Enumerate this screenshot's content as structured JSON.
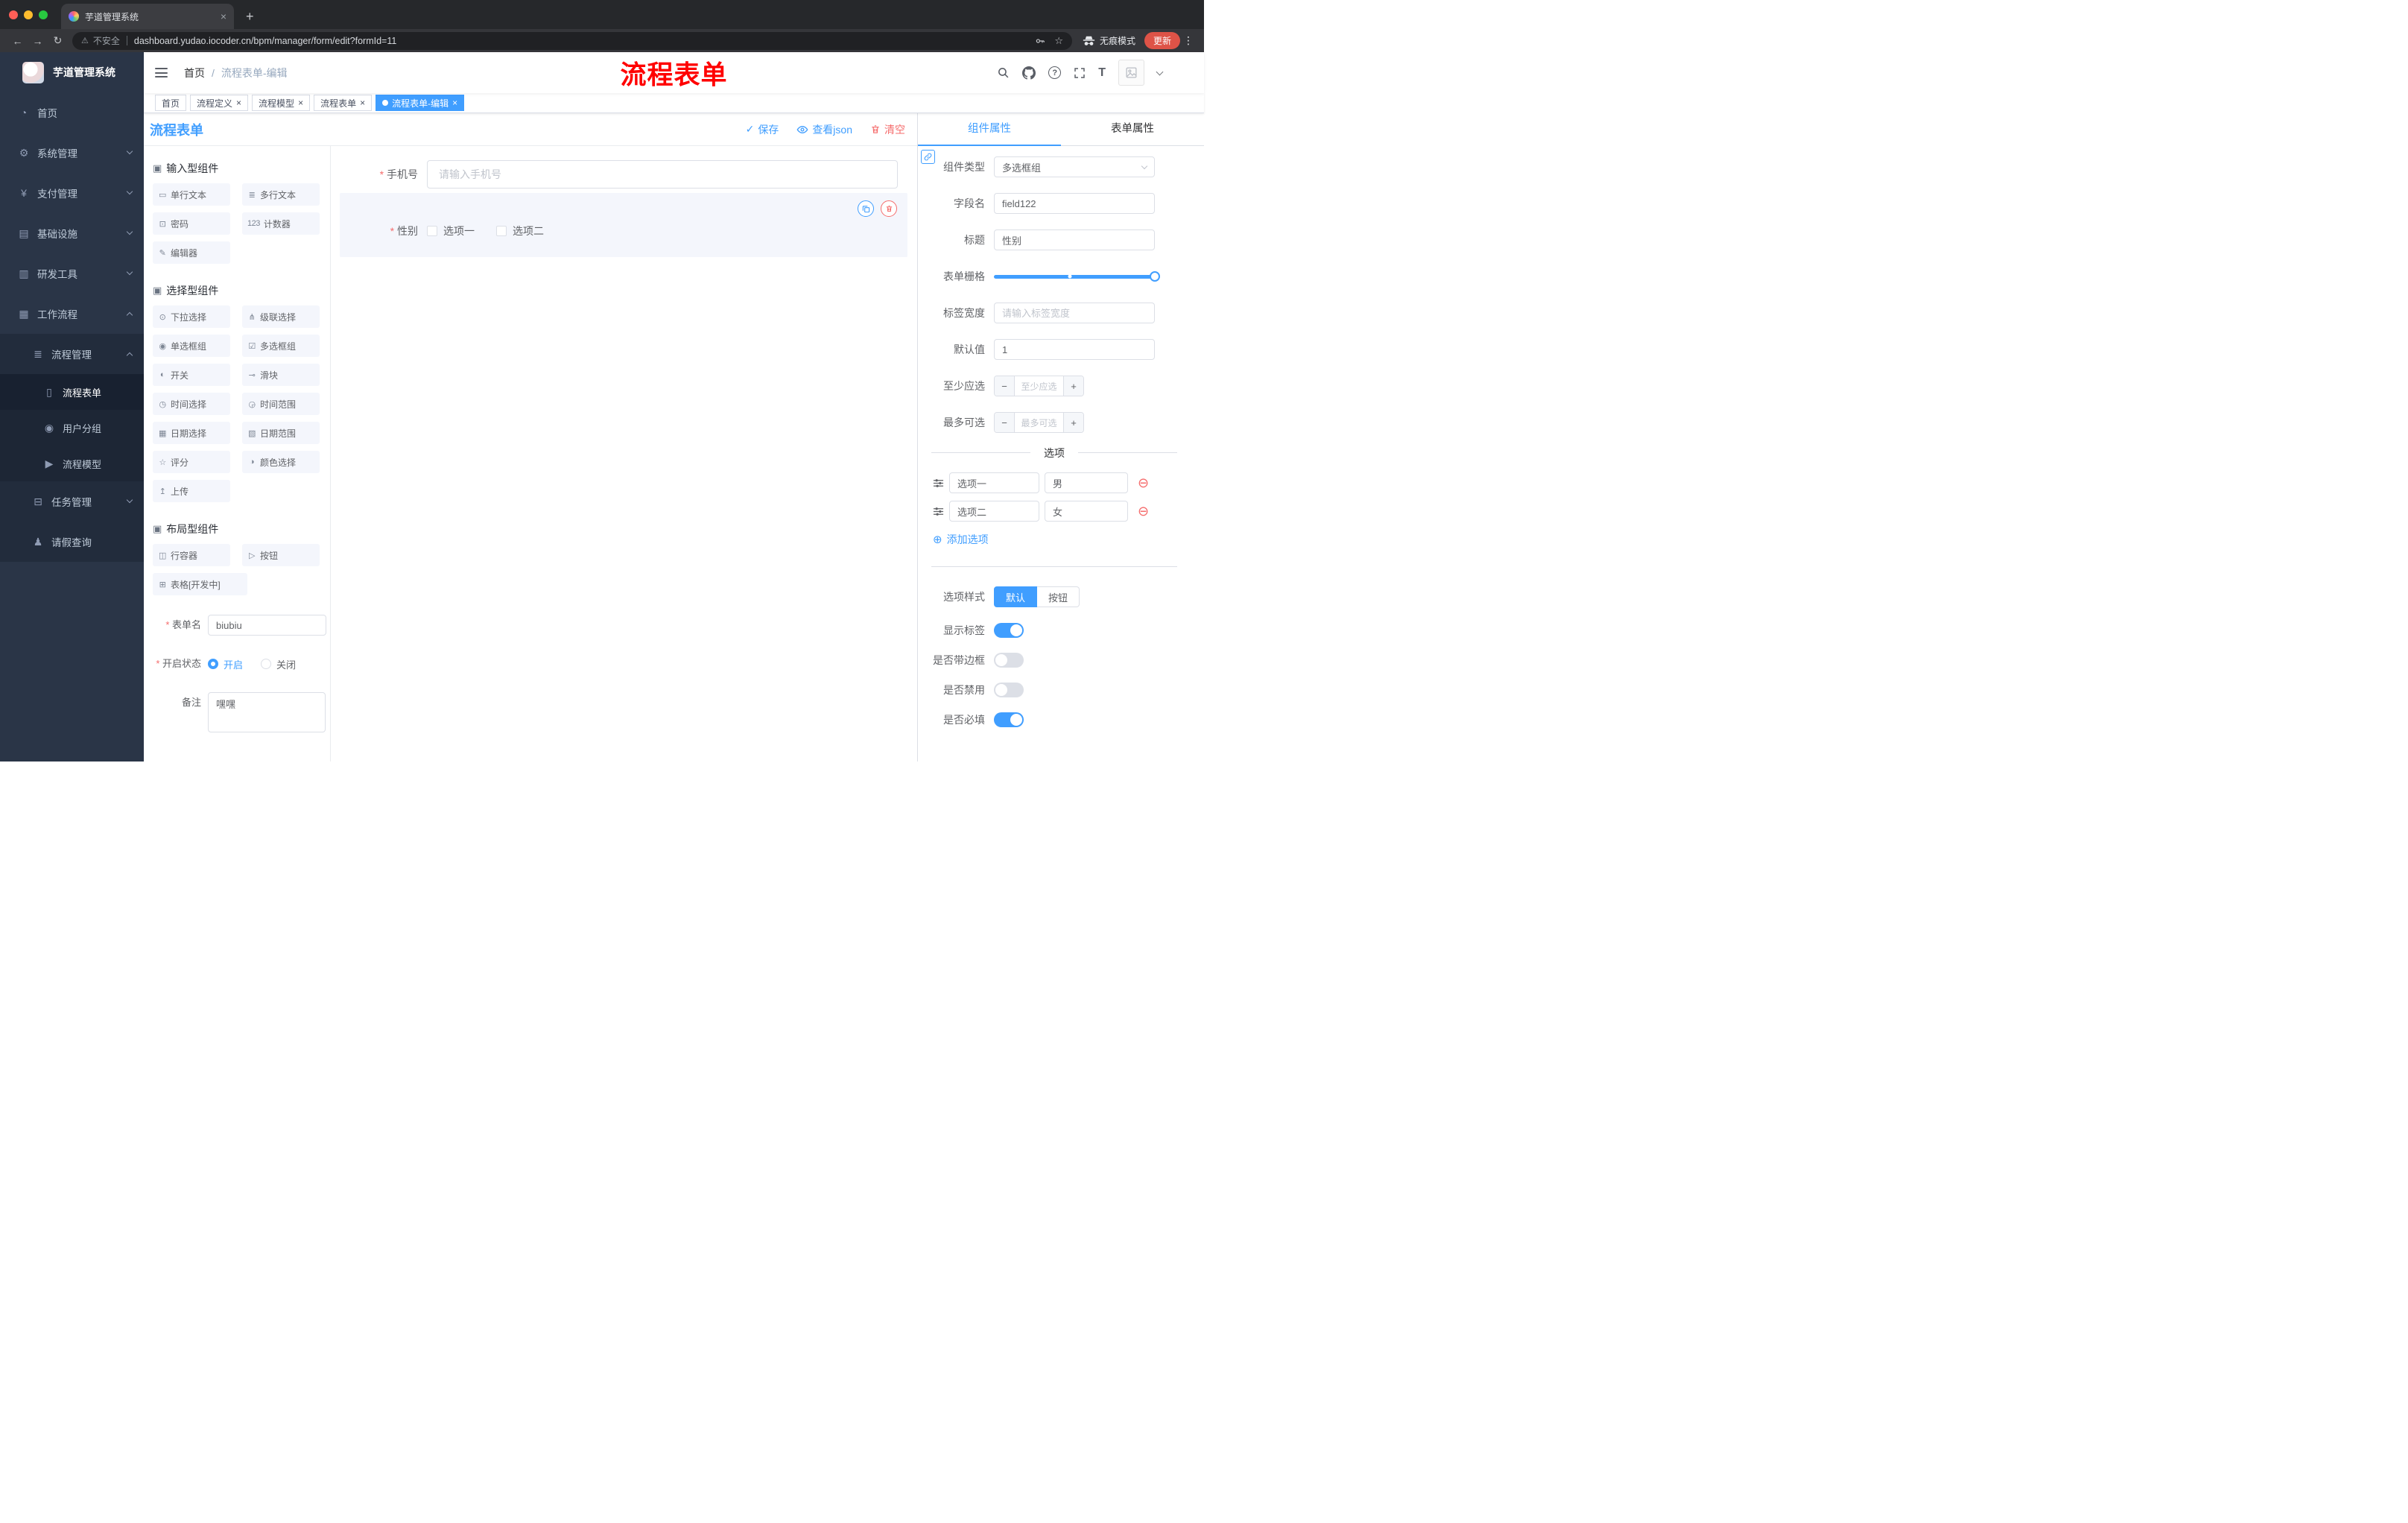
{
  "browser": {
    "tab_title": "芋道管理系统",
    "security_label": "不安全",
    "url": "dashboard.yudao.iocoder.cn/bpm/manager/form/edit?formId=11",
    "incognito_label": "无痕模式",
    "update_label": "更新"
  },
  "sidebar": {
    "app_title": "芋道管理系统",
    "home": "首页",
    "system": "系统管理",
    "payment": "支付管理",
    "infra": "基础设施",
    "devtools": "研发工具",
    "workflow": "工作流程",
    "process_mgmt": "流程管理",
    "process_form": "流程表单",
    "user_group": "用户分组",
    "process_model": "流程模型",
    "task_mgmt": "任务管理",
    "leave_query": "请假查询"
  },
  "navbar": {
    "breadcrumb_home": "首页",
    "breadcrumb_sep": "/",
    "breadcrumb_current": "流程表单-编辑",
    "annotation": "流程表单"
  },
  "tags": [
    {
      "label": "首页"
    },
    {
      "label": "流程定义"
    },
    {
      "label": "流程模型"
    },
    {
      "label": "流程表单"
    },
    {
      "label": "流程表单-编辑"
    }
  ],
  "editor": {
    "title": "流程表单",
    "save": "保存",
    "view_json": "查看json",
    "clear": "清空"
  },
  "library": {
    "group_input": {
      "title": "输入型组件",
      "items": [
        {
          "icon": "▭",
          "label": "单行文本"
        },
        {
          "icon": "≣",
          "label": "多行文本"
        },
        {
          "icon": "⊡",
          "label": "密码"
        },
        {
          "icon": "123",
          "label": "计数器"
        },
        {
          "icon": "✎",
          "label": "编辑器"
        }
      ]
    },
    "group_select": {
      "title": "选择型组件",
      "items": [
        {
          "icon": "⊙",
          "label": "下拉选择"
        },
        {
          "icon": "⋔",
          "label": "级联选择"
        },
        {
          "icon": "◉",
          "label": "单选框组"
        },
        {
          "icon": "☑",
          "label": "多选框组"
        },
        {
          "icon": "◐",
          "label": "开关"
        },
        {
          "icon": "⊸",
          "label": "滑块"
        },
        {
          "icon": "◷",
          "label": "时间选择"
        },
        {
          "icon": "◶",
          "label": "时间范围"
        },
        {
          "icon": "▦",
          "label": "日期选择"
        },
        {
          "icon": "▧",
          "label": "日期范围"
        },
        {
          "icon": "☆",
          "label": "评分"
        },
        {
          "icon": "◑",
          "label": "颜色选择"
        },
        {
          "icon": "↥",
          "label": "上传"
        }
      ]
    },
    "group_layout": {
      "title": "布局型组件",
      "items": [
        {
          "icon": "◫",
          "label": "行容器"
        },
        {
          "icon": "▷",
          "label": "按钮"
        },
        {
          "icon": "⊞",
          "label": "表格[开发中]"
        }
      ]
    }
  },
  "form_meta": {
    "name_label": "表单名",
    "name_value": "biubiu",
    "status_label": "开启状态",
    "status_on": "开启",
    "status_off": "关闭",
    "remark_label": "备注",
    "remark_value": "嘿嘿"
  },
  "canvas": {
    "phone_label": "手机号",
    "phone_placeholder": "请输入手机号",
    "gender_label": "性别",
    "gender_options": [
      "选项一",
      "选项二"
    ]
  },
  "props": {
    "tab_component": "组件属性",
    "tab_form": "表单属性",
    "component_type_label": "组件类型",
    "component_type_value": "多选框组",
    "field_name_label": "字段名",
    "field_name_value": "field122",
    "title_label": "标题",
    "title_value": "性别",
    "grid_label": "表单栅格",
    "label_width_label": "标签宽度",
    "label_width_placeholder": "请输入标签宽度",
    "default_label": "默认值",
    "default_value": "1",
    "min_label": "至少应选",
    "min_placeholder": "至少应选",
    "max_label": "最多可选",
    "max_placeholder": "最多可选",
    "options_title": "选项",
    "options": [
      {
        "name": "选项一",
        "value": "男"
      },
      {
        "name": "选项二",
        "value": "女"
      }
    ],
    "add_option": "添加选项",
    "style_label": "选项样式",
    "style_default": "默认",
    "style_button": "按钮",
    "toggle_show_label": "显示标签",
    "toggle_border": "是否带边框",
    "toggle_disabled": "是否禁用",
    "toggle_required": "是否必填"
  },
  "icons": {
    "check": "✓",
    "warning": "⚠",
    "star": "☆",
    "back": "←",
    "forward": "→",
    "reload": "↻",
    "dots": "⋮",
    "newtab": "+",
    "close": "×",
    "question": "?",
    "font_size": "T",
    "add_circle": "⊕",
    "remove_circle": "⊖",
    "minus": "−",
    "plus": "+",
    "group_cube": "▣",
    "menu_home": "◔",
    "menu_system": "⚙",
    "menu_payment": "¥",
    "menu_infra": "▤",
    "menu_devtools": "▥",
    "menu_workflow": "▦",
    "menu_process": "≣",
    "menu_form": "▯",
    "menu_user_group": "◉",
    "menu_model": "▶",
    "menu_task": "⊟",
    "menu_leave": "♟"
  },
  "colors": {
    "primary": "#409eff",
    "danger": "#f56c6c",
    "annotation_red": "#ff0000"
  }
}
